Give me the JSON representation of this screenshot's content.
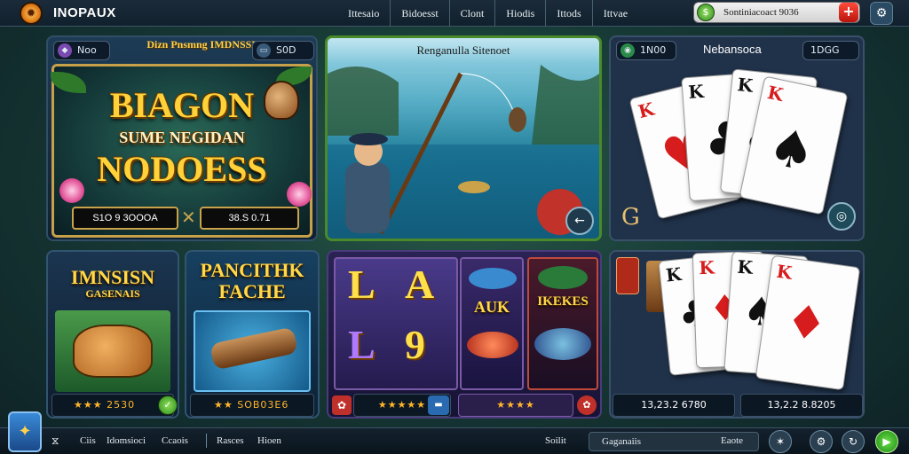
{
  "topbar": {
    "brand": "INOPAUX",
    "nav": [
      "Ittesaio",
      "Bidoesst",
      "Clont",
      "Hiodis",
      "Ittods",
      "Ittvae"
    ],
    "balance_text": "Sontiniacoact 9036",
    "plus_label": "+",
    "settings_icon": "gear-icon"
  },
  "dragon": {
    "pill_left": "Noo",
    "pill_right": "S0D",
    "header": "Dizn Pnsmng IMDNSSEIS",
    "title_line1": "BIAGON",
    "title_line2": "SUME NEGIDAN",
    "title_line3": "NODOESS",
    "stat_left": "S1O 9 3OOOA",
    "stat_right": "38.S 0.71"
  },
  "fishing": {
    "title": "Renganulla Sitenoet"
  },
  "cards_top": {
    "pill": "1N00",
    "title": "Nebansoca",
    "pill_right": "1DGG",
    "cards": [
      {
        "rank": "K",
        "suit": "♥"
      },
      {
        "rank": "K",
        "suit": "♣"
      },
      {
        "rank": "K",
        "suit": "♣"
      },
      {
        "rank": "K",
        "suit": "♠"
      }
    ],
    "badge": "G"
  },
  "mansion": {
    "title_line1": "IMNSISN",
    "title_line2": "GASENAIS",
    "footer": "★★★ 2530"
  },
  "fache": {
    "title_line1": "PANCITHK",
    "title_line2": "FACHE",
    "footer": "★★ SOB03E6"
  },
  "slots": {
    "letters": [
      "L",
      "A",
      "L",
      "9"
    ],
    "right_tile_1": "AUK",
    "right_tile_2": "IKEKES",
    "footer_left_stars": "★★★★★",
    "footer_right_stars": "★★★★"
  },
  "cards_bottom": {
    "cards": [
      {
        "rank": "K",
        "suit": "♣"
      },
      {
        "rank": "K",
        "suit": "♦"
      },
      {
        "rank": "K",
        "suit": "♠"
      },
      {
        "rank": "K",
        "suit": "♦"
      }
    ],
    "footer_left": "13,23.2 6780",
    "footer_right": "13,2.2 8.8205"
  },
  "bottombar": {
    "items": [
      "Ciis",
      "Idomsioci",
      "Ccaois",
      "Rasces",
      "Hioen"
    ],
    "right_label_1": "Soilit",
    "search_text": "Gaganaiis",
    "right_label_2": "Eaote"
  }
}
